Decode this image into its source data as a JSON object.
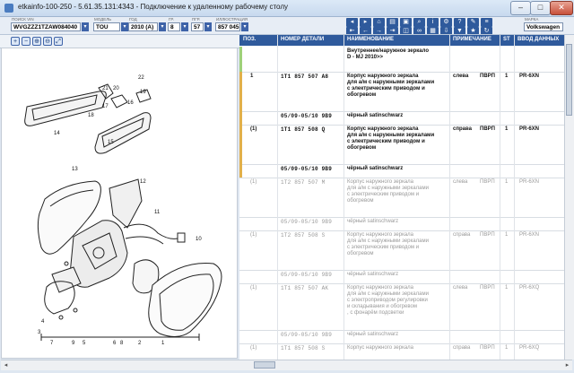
{
  "window": {
    "title": "etkainfo-100-250 - 5.61.35.131:4343 - Подключение к удаленному рабочему столу",
    "min": "–",
    "max": "□",
    "close": "✕"
  },
  "fields": {
    "vin": {
      "label": "ПОИСК VIN",
      "value": "WVGZZZ1TZAW084040"
    },
    "model": {
      "label": "МОДЕЛЬ",
      "value": "TOU"
    },
    "year": {
      "label": "ГОД",
      "value": "2010 (A)"
    },
    "group": {
      "label": "ГР.",
      "value": "8"
    },
    "subgroup": {
      "label": "ПГР.",
      "value": "57"
    },
    "illustration": {
      "label": "ИЛЛЮСТРАЦИЯ",
      "value": "857 045"
    },
    "brand": {
      "label": "МАРКА",
      "value": "Volkswagen"
    }
  },
  "zoom_buttons": [
    "+",
    "−",
    "⊕",
    "⊖",
    "⤢"
  ],
  "columns": [
    "ПОЗ.",
    "НОМЕР ДЕТАЛИ",
    "НАИМЕНОВАНИЕ",
    "ПРИМЕЧАНИЕ",
    "ST",
    "ВВОД ДАННЫХ"
  ],
  "rows": [
    {
      "pos": "",
      "part": "",
      "name": "Внутреннее/наружное зеркало\nD -     MJ 2010>>",
      "note": "",
      "side": "",
      "st": "",
      "data": "",
      "style": "b",
      "mark": "#9fd17a",
      "h": 28
    },
    {
      "pos": "1",
      "part": "1T1 857 507 A8",
      "name": "Корпус наружного зеркала\nдля а/м с наружными зеркалами\nс электрическим приводом и\nобогревом",
      "note": "слева",
      "side": "ПВРП",
      "st": "1",
      "data": "PR-6XN",
      "style": "b",
      "mark": "#e2b04a",
      "h": 44
    },
    {
      "pos": "",
      "part": "05/09-05/10 9B9",
      "name": "чёрный satinschwarz",
      "note": "",
      "side": "",
      "st": "",
      "data": "",
      "style": "b",
      "mark": "#e2b04a",
      "h": 15
    },
    {
      "pos": "(1)",
      "part": "1T1 857 508 Q",
      "name": "Корпус наружного зеркала\nдля а/м с наружными зеркалами\nс электрическим приводом и\nобогревом",
      "note": "справа",
      "side": "ПВРП",
      "st": "1",
      "data": "PR-6XN",
      "style": "b",
      "mark": "#e2b04a",
      "h": 44
    },
    {
      "pos": "",
      "part": "05/09-05/10 9B9",
      "name": "чёрный satinschwarz",
      "note": "",
      "side": "",
      "st": "",
      "data": "",
      "style": "b",
      "mark": "#e2b04a",
      "h": 15
    },
    {
      "pos": "(1)",
      "part": "1T2 857 507 M",
      "name": "Корпус наружного зеркала\nдля а/м с наружными зеркалами\nс электрическим приводом и\nобогревом",
      "note": "слева",
      "side": "ПВРП",
      "st": "1",
      "data": "PR-6XN",
      "style": "g",
      "mark": "",
      "h": 44
    },
    {
      "pos": "",
      "part": "05/09-05/10 9B9",
      "name": "чёрный satinschwarz",
      "note": "",
      "side": "",
      "st": "",
      "data": "",
      "style": "g",
      "mark": "",
      "h": 15
    },
    {
      "pos": "(1)",
      "part": "1T2 857 508 S",
      "name": "Корпус наружного зеркала\nдля а/м с наружными зеркалами\nс электрическим приводом и\nобогревом",
      "note": "справа",
      "side": "ПВРП",
      "st": "1",
      "data": "PR-6XN",
      "style": "g",
      "mark": "",
      "h": 44
    },
    {
      "pos": "",
      "part": "05/09-05/10 9B9",
      "name": "чёрный satinschwarz",
      "note": "",
      "side": "",
      "st": "",
      "data": "",
      "style": "g",
      "mark": "",
      "h": 15
    },
    {
      "pos": "(1)",
      "part": "1T1 857 507 AK",
      "name": "Корпус наружного зеркала\nдля а/м с наружными зеркалами\nс электроприводом регулировки\nи складывания и обогревом\n, с фонарём подсветки",
      "note": "слева",
      "side": "ПВРП",
      "st": "1",
      "data": "PR-6XQ",
      "style": "g",
      "mark": "",
      "h": 52
    },
    {
      "pos": "",
      "part": "05/09-05/10 9B9",
      "name": "чёрный satinschwarz",
      "note": "",
      "side": "",
      "st": "",
      "data": "",
      "style": "g",
      "mark": "",
      "h": 15
    },
    {
      "pos": "(1)",
      "part": "1T1 857 508 S",
      "name": "Корпус наружного зеркала",
      "note": "справа",
      "side": "ПВРП",
      "st": "1",
      "data": "PR-6XQ",
      "style": "g",
      "mark": "",
      "h": 30
    }
  ],
  "illustration_labels": [
    "22",
    "21",
    "20",
    "19",
    "18",
    "17",
    "16",
    "14",
    "15",
    "13",
    "12",
    "11",
    "10",
    "3",
    "4",
    "7",
    "9",
    "5",
    "6",
    "8",
    "2",
    "1"
  ]
}
